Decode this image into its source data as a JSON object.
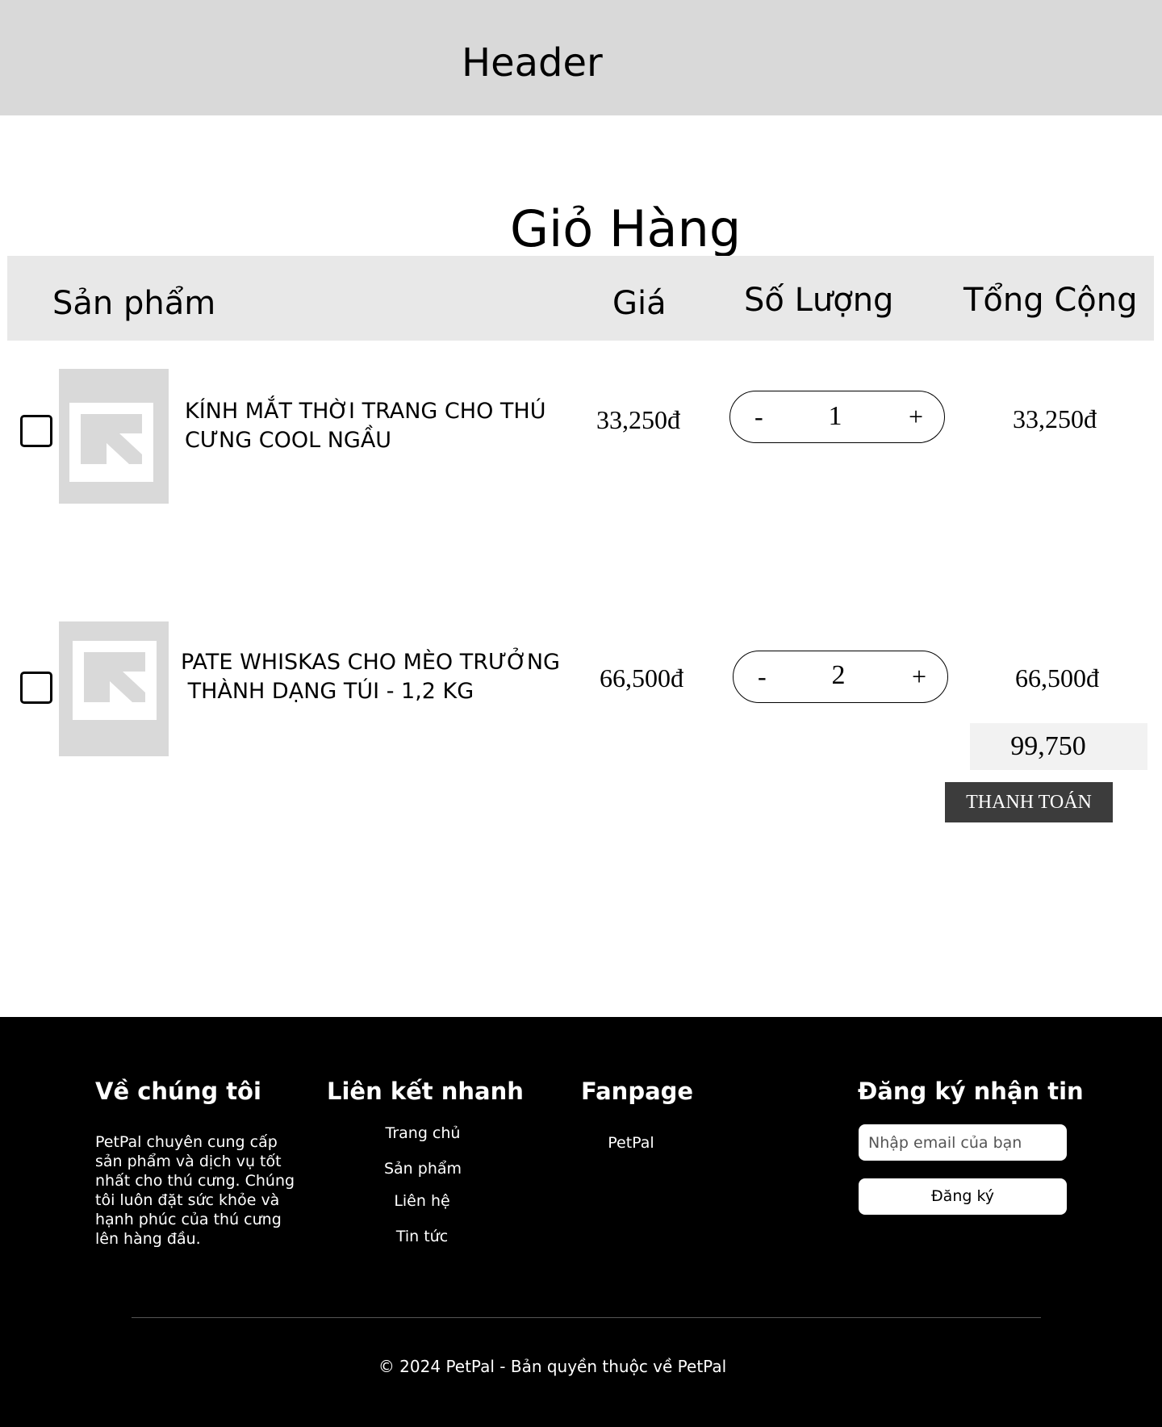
{
  "header": {
    "title": "Header"
  },
  "cart": {
    "title": "Giỏ Hàng",
    "columns": {
      "product": "Sản phẩm",
      "price": "Giá",
      "quantity": "Số Lượng",
      "total": "Tổng Cộng"
    },
    "items": [
      {
        "name": "KÍNH MẮT THỜI TRANG CHO THÚ\nCƯNG COOL NGẦU",
        "price": "33,250đ",
        "quantity": "1",
        "total": "33,250đ",
        "checked": false
      },
      {
        "name": "PATE WHISKAS CHO MÈO TRƯỞNG\n THÀNH DẠNG TÚI - 1,2 KG",
        "price": "66,500đ",
        "quantity": "2",
        "total": "66,500đ",
        "checked": false
      }
    ],
    "stepper": {
      "minus": "-",
      "plus": "+"
    },
    "grand_total": "99,750",
    "checkout_label": "THANH TOÁN"
  },
  "footer": {
    "about": {
      "heading": "Về chúng tôi",
      "text": "PetPal chuyên cung cấp sản phẩm và dịch vụ tốt nhất cho thú cưng. Chúng tôi luôn đặt sức khỏe và hạnh phúc của thú cưng lên hàng đầu."
    },
    "quick_links": {
      "heading": "Liên kết nhanh",
      "items": [
        "Trang chủ",
        "Sản phẩm",
        "Liên hệ",
        "Tin tức"
      ]
    },
    "fanpage": {
      "heading": "Fanpage",
      "link": "PetPal"
    },
    "newsletter": {
      "heading": "Đăng ký nhận tin",
      "placeholder": "Nhập email của bạn",
      "button": "Đăng ký"
    },
    "copyright": "© 2024 PetPal - Bản quyền thuộc về PetPal"
  },
  "colors": {
    "header_bg": "#d9d9d9",
    "table_head_bg": "#e8e8e8",
    "checkout_bg": "#3c3c3c",
    "footer_bg": "#000000"
  }
}
